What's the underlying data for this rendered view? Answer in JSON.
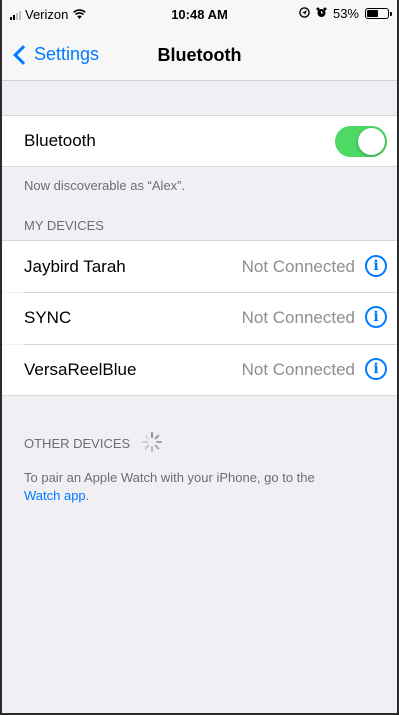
{
  "status_bar": {
    "carrier": "Verizon",
    "time": "10:48 AM",
    "battery_percent": "53%",
    "battery_level": 0.53,
    "icons": [
      "signal-icon",
      "wifi-icon",
      "location-icon",
      "alarm-icon",
      "battery-icon"
    ]
  },
  "nav": {
    "back_label": "Settings",
    "title": "Bluetooth"
  },
  "bluetooth": {
    "label": "Bluetooth",
    "enabled": true,
    "discoverable_text": "Now discoverable as “Alex”."
  },
  "my_devices": {
    "header": "MY DEVICES",
    "items": [
      {
        "name": "Jaybird Tarah",
        "status": "Not Connected"
      },
      {
        "name": "SYNC",
        "status": "Not Connected"
      },
      {
        "name": "VersaReelBlue",
        "status": "Not Connected"
      }
    ]
  },
  "other_devices": {
    "header": "OTHER DEVICES",
    "pair_text": "To pair an Apple Watch with your iPhone, go to the",
    "pair_link": "Watch app",
    "pair_suffix": "."
  },
  "colors": {
    "accent": "#007aff",
    "toggle_on": "#4cd964",
    "grouped_background": "#efeff4",
    "secondary_text": "#8e8e93"
  }
}
